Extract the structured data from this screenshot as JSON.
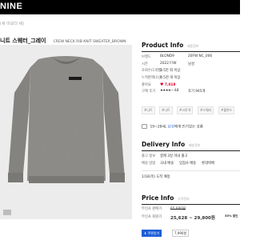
{
  "header": {
    "brand": "NINE"
  },
  "breadcrumb": "(세 이모더 세)",
  "product": {
    "title_ko": "니트 스웨터_그레이",
    "title_en": "CREW NECK RIB KNIT SWEATER_BROWN",
    "image_badge": "■"
  },
  "product_info": {
    "heading": "Product Info",
    "sub": "제품정보",
    "rows": [
      {
        "key": "브랜드",
        "value": "BLOND9",
        "value2": "20FW NC_006"
      },
      {
        "key": "시즌",
        "value": "2022 F/W",
        "value2": "남성"
      },
      {
        "key": "조회수(1개월)",
        "value": "1.5만 회 이상",
        "value2": ""
      },
      {
        "key": "누적판매(1년)",
        "value": "4.5천 개 이상",
        "value2": ""
      },
      {
        "key": "좋아요",
        "value": "7,018",
        "value2": ""
      },
      {
        "key": "구매 후기",
        "value": "★★★★☆ 4.8",
        "value2": "후기 945개"
      }
    ]
  },
  "tags": [
    "#니트",
    "#니트",
    "#크루넥",
    "#스웨터",
    "#블론드"
  ],
  "notice": {
    "prefix": "19~28세,",
    "highlight": "남성",
    "suffix": "에게 인기있는 상품"
  },
  "delivery_info": {
    "heading": "Delivery Info",
    "sub": "배송정보",
    "rows": [
      {
        "key": "출고 정보",
        "value": "결제 3일 이내 출고"
      },
      {
        "key": "배송 방법",
        "value": "국내 배송",
        "value2": "입점사 배송",
        "value3": "롯데택배"
      }
    ],
    "arrival": "1/18(목) 도착 예정"
  },
  "price_info": {
    "heading": "Price Info",
    "sub": "가격정보",
    "rows": [
      {
        "key": "무신사 판매가",
        "value": "65,600원"
      },
      {
        "key": "무신사 회원가",
        "value": "25,628 ~ 29,800원",
        "badge": "55% 할인"
      }
    ],
    "coupon_label": "쿠폰받기",
    "coupon_price": "7,990원"
  }
}
